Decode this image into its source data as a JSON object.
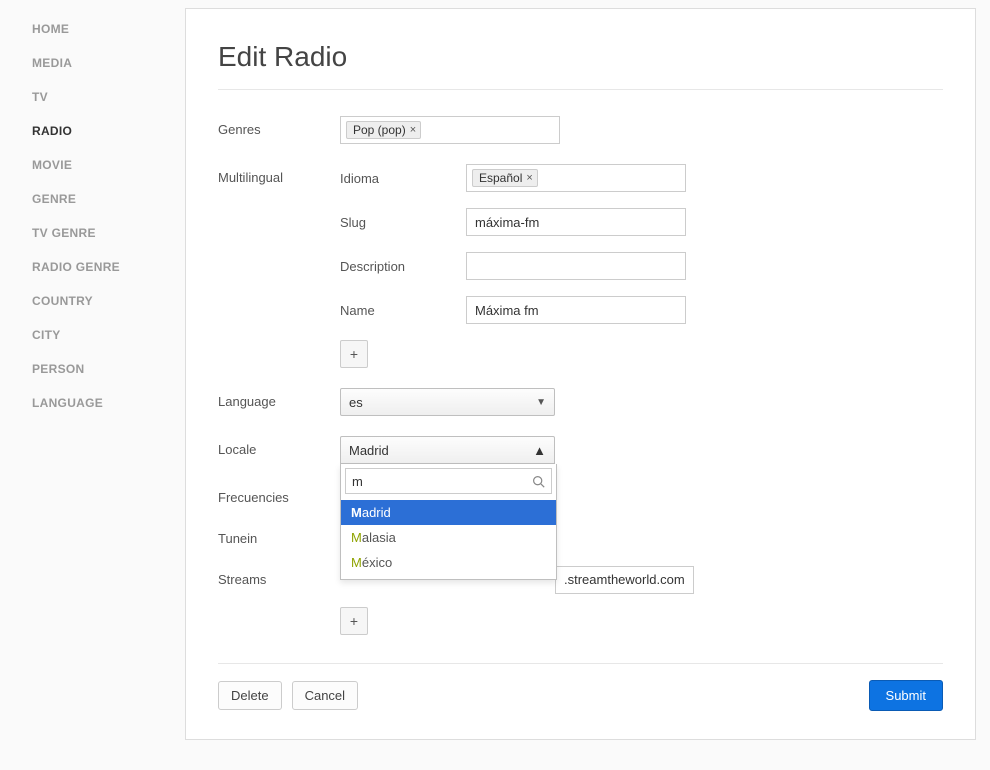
{
  "sidebar": {
    "items": [
      {
        "label": "HOME"
      },
      {
        "label": "MEDIA"
      },
      {
        "label": "TV"
      },
      {
        "label": "RADIO",
        "active": true
      },
      {
        "label": "MOVIE"
      },
      {
        "label": "GENRE"
      },
      {
        "label": "TV GENRE"
      },
      {
        "label": "RADIO GENRE"
      },
      {
        "label": "COUNTRY"
      },
      {
        "label": "CITY"
      },
      {
        "label": "PERSON"
      },
      {
        "label": "LANGUAGE"
      }
    ]
  },
  "page": {
    "title": "Edit Radio"
  },
  "form": {
    "genres_label": "Genres",
    "genres_tag": "Pop (pop)",
    "multilingual_label": "Multilingual",
    "idioma_label": "Idioma",
    "idioma_tag": "Español",
    "slug_label": "Slug",
    "slug_value": "máxima-fm",
    "description_label": "Description",
    "description_value": "",
    "name_label": "Name",
    "name_value": "Máxima fm",
    "add_label": "+",
    "language_label": "Language",
    "language_value": "es",
    "locale_label": "Locale",
    "locale_value": "Madrid",
    "locale_search": "m",
    "locale_options": [
      "Madrid",
      "Malasia",
      "México"
    ],
    "frecuencies_label": "Frecuencies",
    "tunein_label": "Tunein",
    "streams_label": "Streams",
    "streams_suffix": ".streamtheworld.com",
    "add_stream_label": "+"
  },
  "footer": {
    "delete": "Delete",
    "cancel": "Cancel",
    "submit": "Submit"
  }
}
